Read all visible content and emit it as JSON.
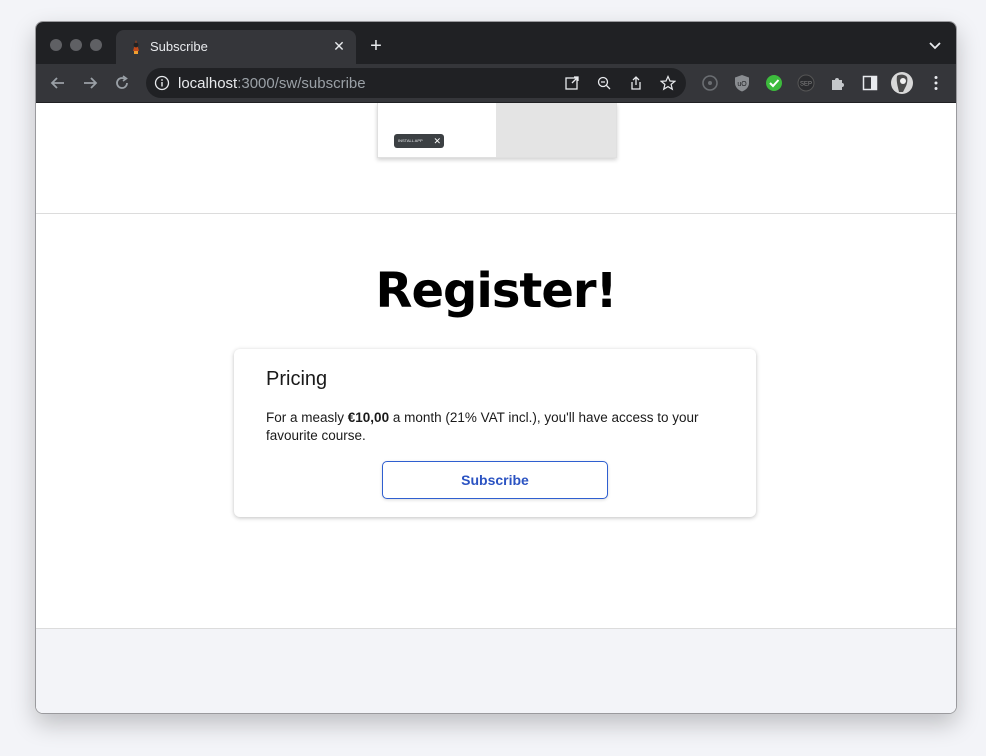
{
  "browser": {
    "tab_title": "Subscribe",
    "tab_close": "✕",
    "new_tab": "+",
    "url_host": "localhost",
    "url_path": ":3000/sw/subscribe"
  },
  "thumbnail": {
    "install_chip_label": "INSTALL APP",
    "install_chip_close": "✕"
  },
  "main": {
    "heading": "Register!",
    "card": {
      "title": "Pricing",
      "text_before": "For a measly ",
      "price": "€10,00",
      "text_after": " a month (21% VAT incl.), you'll have access to your favourite course.",
      "button_label": "Subscribe"
    }
  },
  "colors": {
    "chrome_dark": "#202124",
    "toolbar": "#35363a",
    "accent_blue": "#2b53c2",
    "footer_bg": "#f3f4f8"
  }
}
